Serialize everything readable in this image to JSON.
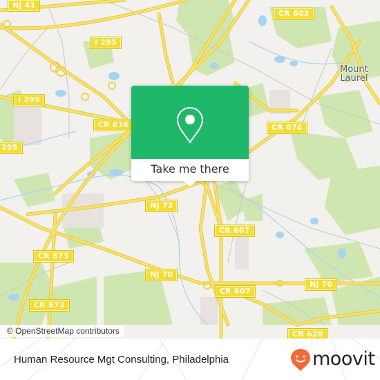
{
  "map": {
    "route_shields": [
      {
        "id": "nj41",
        "label": "NJ 41"
      },
      {
        "id": "i295-top",
        "label": "I 295"
      },
      {
        "id": "i295-mid",
        "label": "I 295"
      },
      {
        "id": "i295-left",
        "label": "295"
      },
      {
        "id": "cr616",
        "label": "CR 616"
      },
      {
        "id": "cr603",
        "label": "CR 603"
      },
      {
        "id": "cr674",
        "label": "CR 674"
      },
      {
        "id": "nj73",
        "label": "NJ 73"
      },
      {
        "id": "cr607-top",
        "label": "CR 607"
      },
      {
        "id": "cr607-bottom",
        "label": "CR 607"
      },
      {
        "id": "cr673-top",
        "label": "CR 673"
      },
      {
        "id": "cr673-bottom",
        "label": "CR 673"
      },
      {
        "id": "nj70-left",
        "label": "NJ 70"
      },
      {
        "id": "nj70-right",
        "label": "NJ 70"
      },
      {
        "id": "cr620",
        "label": "CR 620"
      }
    ],
    "places": [
      {
        "id": "mount-laurel",
        "line1": "Mount",
        "line2": "Laurel"
      }
    ],
    "attribution": "© OpenStreetMap contributors",
    "colors": {
      "land": "#f2f1ed",
      "park": "#cfe6b0",
      "water": "#a8d4ef",
      "road_major": "#f5dc5a",
      "road_minor": "#c9c6c0",
      "shield": "#f5dc30"
    }
  },
  "popup": {
    "icon": "map-pin-icon",
    "button_label": "Take me there",
    "color": "#1fb86a"
  },
  "footer": {
    "title": "Human Resource Mgt Consulting, Philadelphia",
    "brand": "moovit",
    "brand_color": "#f26a36"
  }
}
